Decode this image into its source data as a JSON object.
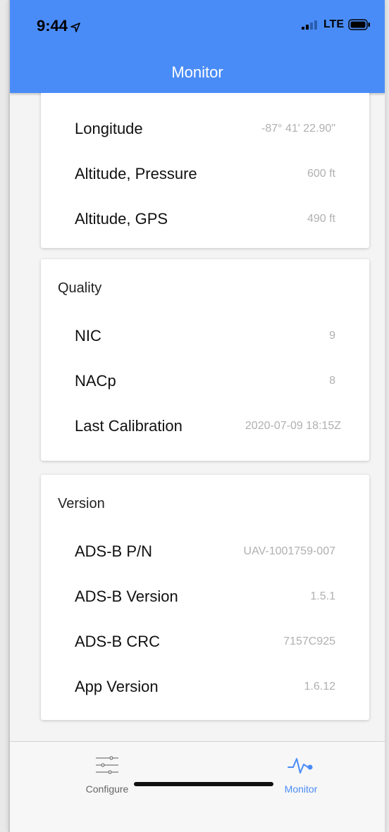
{
  "status": {
    "time": "9:44",
    "network": "LTE"
  },
  "header": {
    "title": "Monitor"
  },
  "position": {
    "rows": [
      {
        "label": "Longitude",
        "value": "-87° 41' 22.90\""
      },
      {
        "label": "Altitude, Pressure",
        "value": "600 ft"
      },
      {
        "label": "Altitude, GPS",
        "value": "490 ft"
      }
    ]
  },
  "quality": {
    "title": "Quality",
    "rows": [
      {
        "label": "NIC",
        "value": "9"
      },
      {
        "label": "NACp",
        "value": "8"
      },
      {
        "label": "Last Calibration",
        "value": "2020-07-09 18:15Z"
      }
    ]
  },
  "version": {
    "title": "Version",
    "rows": [
      {
        "label": "ADS-B P/N",
        "value": "UAV-1001759-007"
      },
      {
        "label": "ADS-B Version",
        "value": "1.5.1"
      },
      {
        "label": "ADS-B CRC",
        "value": "7157C925"
      },
      {
        "label": "App Version",
        "value": "1.6.12"
      }
    ]
  },
  "tabs": [
    {
      "label": "Configure",
      "icon": "sliders-icon",
      "active": false
    },
    {
      "label": "Monitor",
      "icon": "pulse-icon",
      "active": true
    }
  ],
  "colors": {
    "accent": "#4a8cf7",
    "value_text": "#b0b0b0"
  }
}
